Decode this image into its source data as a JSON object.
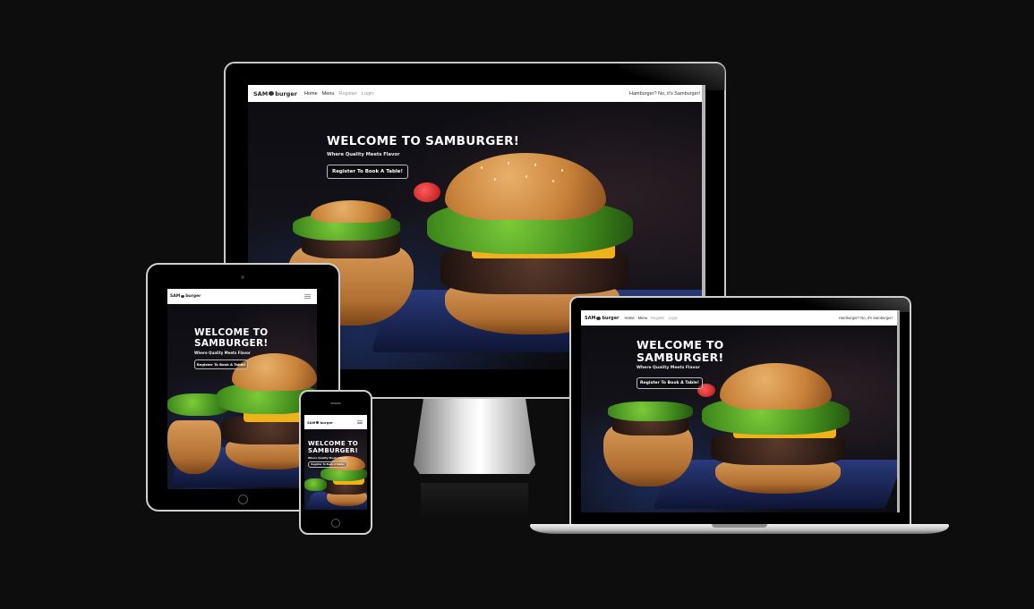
{
  "site": {
    "logo_pre": "SAM",
    "logo_post": "burger",
    "nav": [
      {
        "label": "Home",
        "muted": false
      },
      {
        "label": "Menu",
        "muted": false
      },
      {
        "label": "Register",
        "muted": true
      },
      {
        "label": "Login",
        "muted": true
      }
    ],
    "tagline": "Hamburger? No, it's Samburger!",
    "hero_title": "WELCOME TO SAMBURGER!",
    "hero_subtitle": "Where Quality Meets Flavor",
    "hero_button": "Register To Book A Table!"
  },
  "colors": {
    "background": "#0e0d0e",
    "bezel": "#000000",
    "navbar": "#ffffff",
    "hero_text": "#ffffff"
  }
}
